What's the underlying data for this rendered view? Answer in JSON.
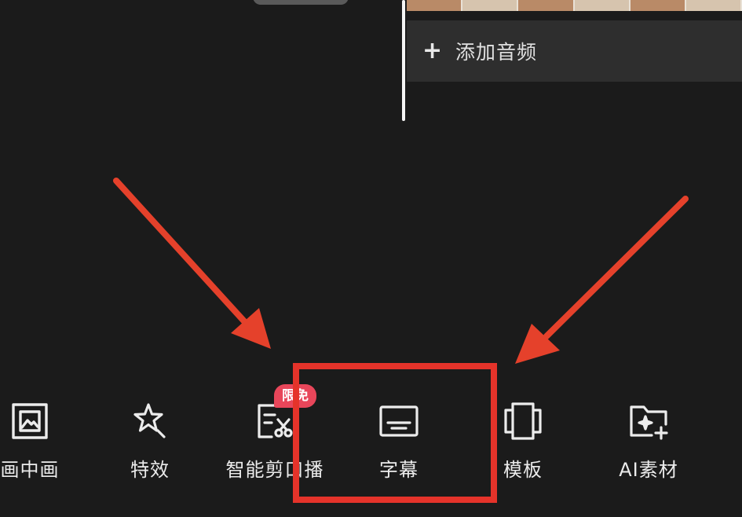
{
  "timeline": {
    "add_audio_label": "添加音频",
    "add_audio_icon": "plus-icon"
  },
  "toolbar": {
    "items": [
      {
        "label": "画中画",
        "icon": "picture-in-picture-icon"
      },
      {
        "label": "特效",
        "icon": "star-sparkle-icon"
      },
      {
        "label": "智能剪口播",
        "icon": "smart-cut-icon",
        "badge": "限免"
      },
      {
        "label": "字幕",
        "icon": "subtitle-icon"
      },
      {
        "label": "模板",
        "icon": "template-icon"
      },
      {
        "label": "AI素材",
        "icon": "ai-folder-icon"
      }
    ]
  },
  "annotations": {
    "highlight_color": "#e5332a",
    "highlighted_item": "字幕"
  },
  "colors": {
    "background": "#1b1b1b",
    "track": "#2e2e2e",
    "badge": "#e8465a",
    "arrow": "#e5412b"
  }
}
